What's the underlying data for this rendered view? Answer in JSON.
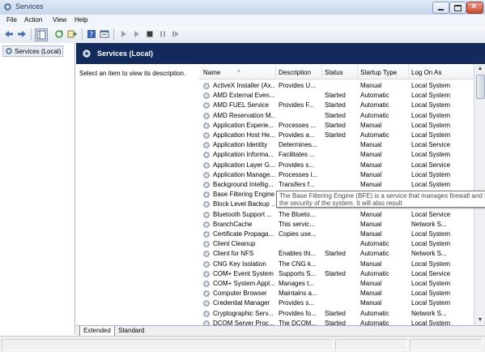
{
  "window": {
    "title": "Services",
    "accent": "#132a5c"
  },
  "menu": [
    "File",
    "Action",
    "View",
    "Help"
  ],
  "toolbar_icons": [
    "back-arrow-icon",
    "forward-arrow-icon",
    "show-hide-tree-icon",
    "refresh-icon",
    "export-list-icon",
    "help-icon",
    "properties-icon",
    "start-service-icon",
    "start-alt-icon",
    "stop-service-icon",
    "pause-service-icon",
    "restart-service-icon"
  ],
  "tree": {
    "root": "Services (Local)"
  },
  "header": {
    "title": "Services (Local)"
  },
  "description_pane": {
    "hint": "Select an item to view its description."
  },
  "columns": {
    "name": "Name",
    "description": "Description",
    "status": "Status",
    "startup": "Startup Type",
    "logon": "Log On As"
  },
  "services": [
    {
      "name": "ActiveX Installer (Ax...",
      "description": "Provides U...",
      "status": "",
      "startup": "Manual",
      "logon": "Local System"
    },
    {
      "name": "AMD External Even...",
      "description": "",
      "status": "Started",
      "startup": "Automatic",
      "logon": "Local System"
    },
    {
      "name": "AMD FUEL Service",
      "description": "Provides F...",
      "status": "Started",
      "startup": "Automatic",
      "logon": "Local System"
    },
    {
      "name": "AMD Reservation M...",
      "description": "",
      "status": "Started",
      "startup": "Automatic",
      "logon": "Local System"
    },
    {
      "name": "Application Experie...",
      "description": "Processes ...",
      "status": "Started",
      "startup": "Manual",
      "logon": "Local System"
    },
    {
      "name": "Application Host He...",
      "description": "Provides a...",
      "status": "Started",
      "startup": "Automatic",
      "logon": "Local System"
    },
    {
      "name": "Application Identity",
      "description": "Determines...",
      "status": "",
      "startup": "Manual",
      "logon": "Local Service"
    },
    {
      "name": "Application Informa...",
      "description": "Facilitates ...",
      "status": "",
      "startup": "Manual",
      "logon": "Local System"
    },
    {
      "name": "Application Layer G...",
      "description": "Provides s...",
      "status": "",
      "startup": "Manual",
      "logon": "Local Service"
    },
    {
      "name": "Application Manage...",
      "description": "Processes i...",
      "status": "",
      "startup": "Manual",
      "logon": "Local System"
    },
    {
      "name": "Background Intellig...",
      "description": "Transfers f...",
      "status": "",
      "startup": "Manual",
      "logon": "Local System"
    },
    {
      "name": "Base Filtering Engine",
      "description": "",
      "status": "",
      "startup": "",
      "logon": ""
    },
    {
      "name": "Block Level Backup ...",
      "description": "",
      "status": "",
      "startup": "",
      "logon": ""
    },
    {
      "name": "Bluetooth Support ...",
      "description": "The Blueto...",
      "status": "",
      "startup": "Manual",
      "logon": "Local Service"
    },
    {
      "name": "BranchCache",
      "description": "This servic...",
      "status": "",
      "startup": "Manual",
      "logon": "Network S..."
    },
    {
      "name": "Certificate Propaga...",
      "description": "Copies use...",
      "status": "",
      "startup": "Manual",
      "logon": "Local System"
    },
    {
      "name": "Client Cleanup",
      "description": "",
      "status": "",
      "startup": "Automatic",
      "logon": "Local System"
    },
    {
      "name": "Client for NFS",
      "description": "Enables thi...",
      "status": "Started",
      "startup": "Automatic",
      "logon": "Network S..."
    },
    {
      "name": "CNG Key Isolation",
      "description": "The CNG k...",
      "status": "",
      "startup": "Manual",
      "logon": "Local System"
    },
    {
      "name": "COM+ Event System",
      "description": "Supports S...",
      "status": "Started",
      "startup": "Automatic",
      "logon": "Local Service"
    },
    {
      "name": "COM+ System Appl...",
      "description": "Manages t...",
      "status": "",
      "startup": "Manual",
      "logon": "Local System"
    },
    {
      "name": "Computer Browser",
      "description": "Maintains a...",
      "status": "",
      "startup": "Manual",
      "logon": "Local System"
    },
    {
      "name": "Credential Manager",
      "description": "Provides s...",
      "status": "",
      "startup": "Manual",
      "logon": "Local System"
    },
    {
      "name": "Cryptographic Serv...",
      "description": "Provides fo...",
      "status": "Started",
      "startup": "Automatic",
      "logon": "Network S..."
    },
    {
      "name": "DCOM Server Proc...",
      "description": "The DCOM...",
      "status": "Started",
      "startup": "Automatic",
      "logon": "Local System"
    }
  ],
  "tooltip": {
    "line1": "The Base Filtering Engine (BFE) is a service that manages firewall and Inte",
    "line2": "the security of the system. It will also result"
  },
  "tabs": {
    "extended": "Extended",
    "standard": "Standard"
  }
}
